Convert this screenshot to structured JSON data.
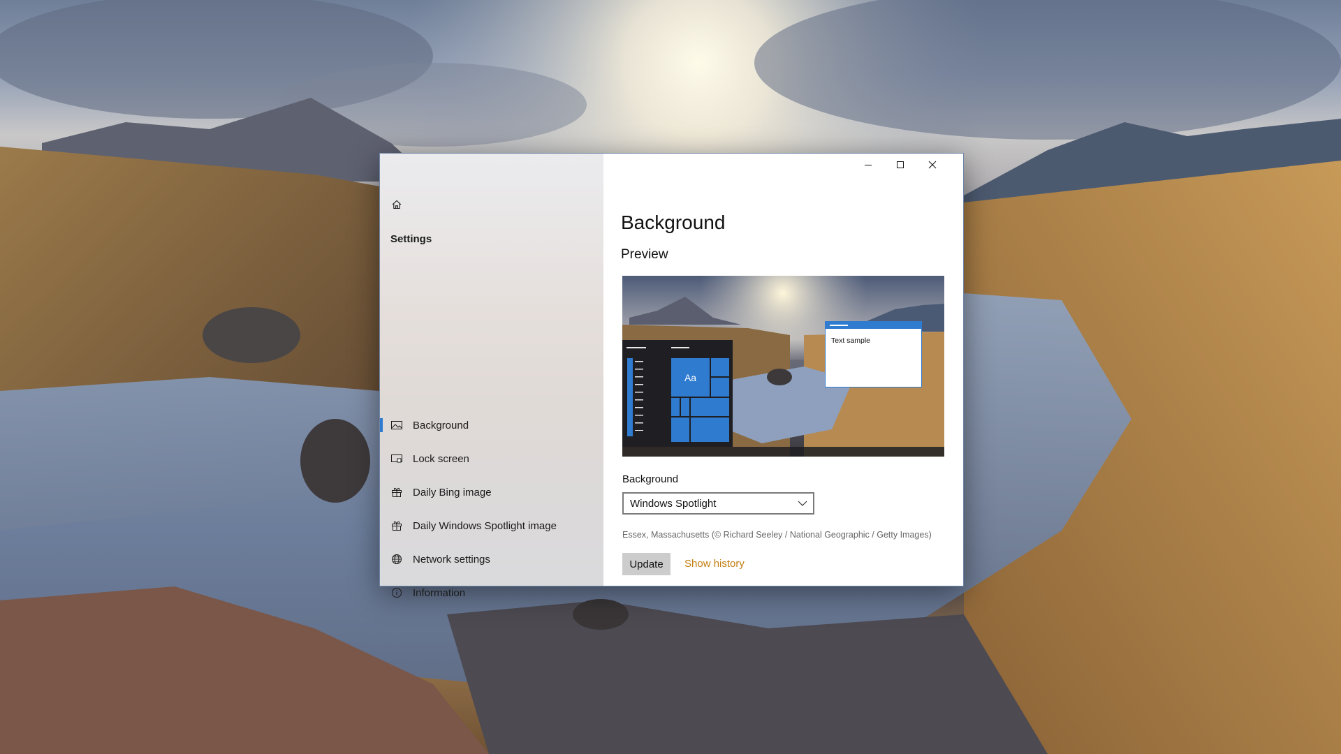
{
  "window": {
    "sidebar_title": "Settings",
    "controls": {
      "minimize": "minimize-icon",
      "maximize": "maximize-icon",
      "close": "close-icon"
    }
  },
  "sidebar": {
    "items": [
      {
        "label": "Background",
        "icon": "image-icon",
        "selected": true
      },
      {
        "label": "Lock screen",
        "icon": "lock-screen-icon",
        "selected": false
      },
      {
        "label": "Daily Bing image",
        "icon": "gift-icon",
        "selected": false
      },
      {
        "label": "Daily Windows Spotlight image",
        "icon": "gift-icon",
        "selected": false
      },
      {
        "label": "Network settings",
        "icon": "globe-icon",
        "selected": false
      },
      {
        "label": "Information",
        "icon": "info-icon",
        "selected": false
      }
    ]
  },
  "main": {
    "title": "Background",
    "preview_heading": "Preview",
    "preview": {
      "tile_label": "Aa",
      "window_text": "Text sample"
    },
    "background_label": "Background",
    "background_value": "Windows Spotlight",
    "image_credit": "Essex, Massachusetts (© Richard Seeley / National Geographic / Getty Images)",
    "update_button": "Update",
    "history_link": "Show history"
  },
  "colors": {
    "accent": "#2e7bd0",
    "link": "#c27d0e",
    "button_bg": "#cccccc"
  }
}
